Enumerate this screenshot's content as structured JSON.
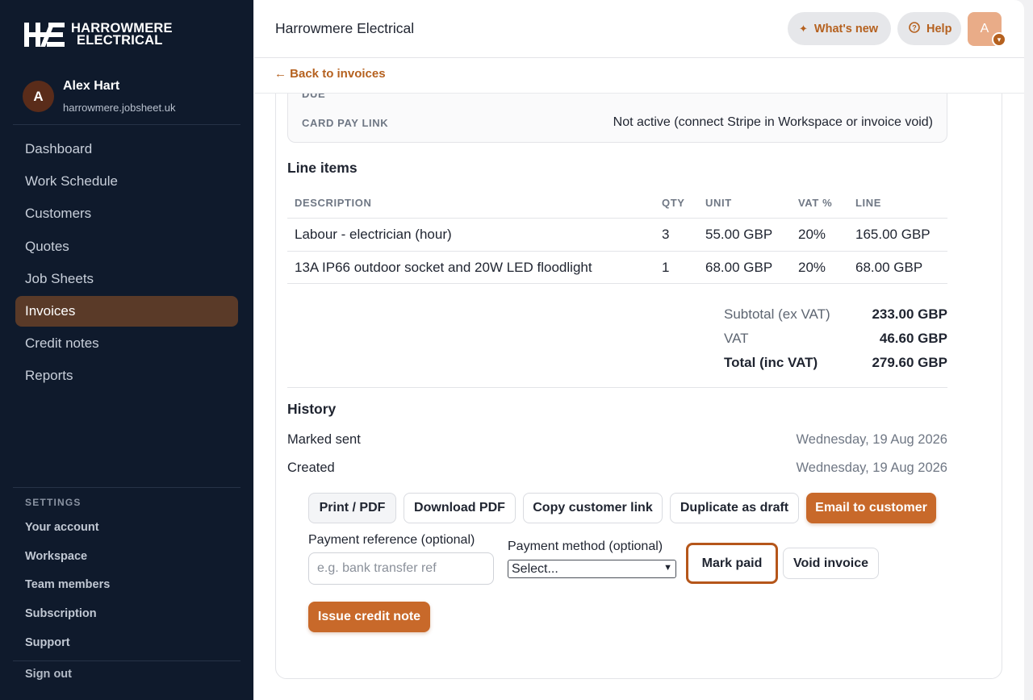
{
  "brand": {
    "logo_mark": "HE",
    "logo_line1": "HARROWMERE",
    "logo_line2": "ELECTRICAL"
  },
  "user": {
    "initial": "A",
    "name": "Alex Hart",
    "domain": "harrowmere.jobsheet.uk"
  },
  "nav": [
    {
      "label": "Dashboard",
      "active": false
    },
    {
      "label": "Work Schedule",
      "active": false
    },
    {
      "label": "Customers",
      "active": false
    },
    {
      "label": "Quotes",
      "active": false
    },
    {
      "label": "Job Sheets",
      "active": false
    },
    {
      "label": "Invoices",
      "active": true
    },
    {
      "label": "Credit notes",
      "active": false
    },
    {
      "label": "Reports",
      "active": false
    }
  ],
  "settings": {
    "heading": "SETTINGS",
    "items": [
      "Your account",
      "Workspace",
      "Team members",
      "Subscription",
      "Support"
    ],
    "sign_out": "Sign out"
  },
  "topbar": {
    "title": "Harrowmere Electrical",
    "whats_new": "What's new",
    "help": "Help",
    "avatar_initial": "A",
    "whats_new_icon": "sparkle-icon",
    "help_icon": "question-circle-icon"
  },
  "back_link": "← Back to invoices",
  "invoice_details": {
    "due_label": "DUE",
    "card_pay_label": "CARD PAY LINK",
    "card_pay_value": "Not active (connect Stripe in Workspace or invoice void)"
  },
  "line_items": {
    "title": "Line items",
    "headers": {
      "description": "DESCRIPTION",
      "qty": "QTY",
      "unit": "UNIT",
      "vat": "VAT %",
      "line": "LINE"
    },
    "rows": [
      {
        "description": "Labour - electrician (hour)",
        "qty": "3",
        "unit": "55.00 GBP",
        "vat": "20%",
        "line": "165.00 GBP"
      },
      {
        "description": "13A IP66 outdoor socket and 20W LED floodlight",
        "qty": "1",
        "unit": "68.00 GBP",
        "vat": "20%",
        "line": "68.00 GBP"
      }
    ]
  },
  "totals": {
    "subtotal_label": "Subtotal (ex VAT)",
    "subtotal_value": "233.00 GBP",
    "vat_label": "VAT",
    "vat_value": "46.60 GBP",
    "total_label": "Total (inc VAT)",
    "total_value": "279.60 GBP"
  },
  "history": {
    "title": "History",
    "events": [
      {
        "label": "Marked sent",
        "date": "Wednesday, 19 Aug 2026"
      },
      {
        "label": "Created",
        "date": "Wednesday, 19 Aug 2026"
      }
    ]
  },
  "actions": {
    "print_pdf": "Print / PDF",
    "download_pdf": "Download PDF",
    "copy_link": "Copy customer link",
    "duplicate": "Duplicate as draft",
    "email": "Email to customer",
    "mark_paid": "Mark paid",
    "void": "Void invoice",
    "issue_credit": "Issue credit note"
  },
  "payment": {
    "reference_label": "Payment reference (optional)",
    "reference_placeholder": "e.g. bank transfer ref",
    "method_label": "Payment method (optional)",
    "method_value": "Select..."
  },
  "colors": {
    "accent": "#c8692a",
    "sidebar_bg": "#0f1a2c",
    "active_nav": "#5a3a28"
  }
}
